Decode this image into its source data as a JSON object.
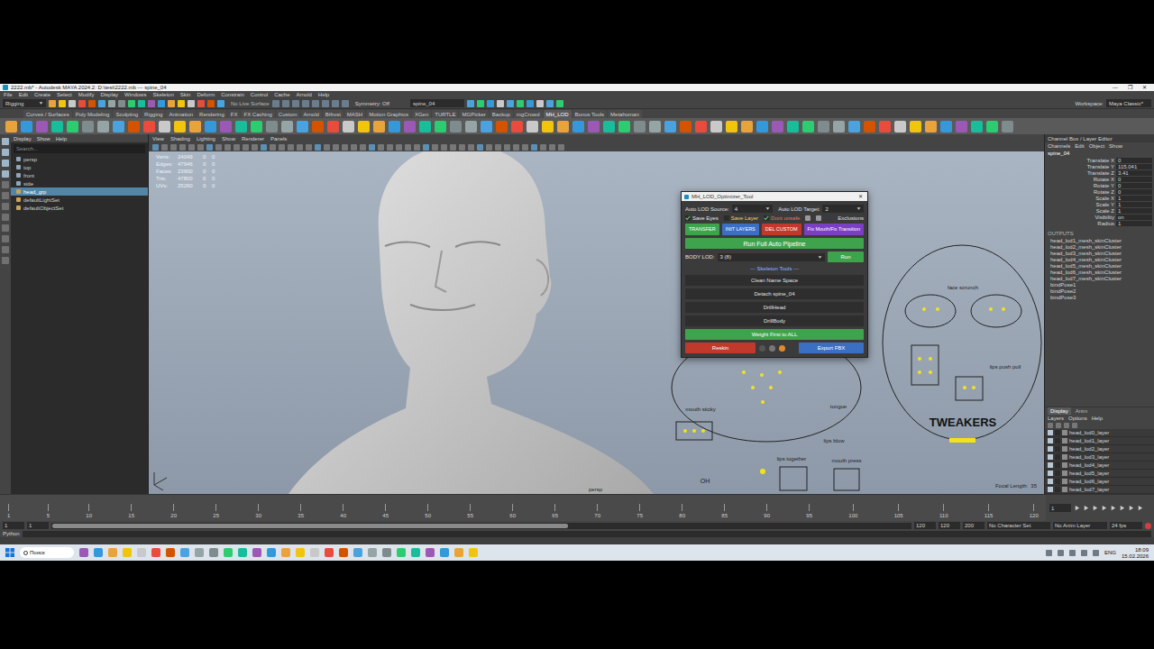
{
  "window": {
    "title": "2222.mb* - Autodesk MAYA 2024.2: D:\\test\\2222.mb   ---   spine_04",
    "controls": [
      "—",
      "❐",
      "✕"
    ]
  },
  "menu": [
    "File",
    "Edit",
    "Create",
    "Select",
    "Modify",
    "Display",
    "Windows",
    "Skeleton",
    "Skin",
    "Deform",
    "Constrain",
    "Control",
    "Cache",
    "Arnold",
    "Help"
  ],
  "status_line": {
    "mode": "Rigging",
    "live_surface": "No Live Surface",
    "symmetry": "Symmetry: Off",
    "object": "spine_04",
    "workspace_label": "Workspace:",
    "workspace": "Maya Classic*"
  },
  "shelf_tabs": [
    {
      "label": "Curves / Surfaces",
      "selected": false
    },
    {
      "label": "Poly Modeling",
      "selected": false
    },
    {
      "label": "Sculpting",
      "selected": false
    },
    {
      "label": "Rigging",
      "selected": false
    },
    {
      "label": "Animation",
      "selected": false
    },
    {
      "label": "Rendering",
      "selected": false
    },
    {
      "label": "FX",
      "selected": false
    },
    {
      "label": "FX Caching",
      "selected": false
    },
    {
      "label": "Custom",
      "selected": false
    },
    {
      "label": "Arnold",
      "selected": false
    },
    {
      "label": "Bifrost",
      "selected": false
    },
    {
      "label": "MASH",
      "selected": false
    },
    {
      "label": "Motion Graphics",
      "selected": false
    },
    {
      "label": "XGen",
      "selected": false
    },
    {
      "label": "TURTLE",
      "selected": false
    },
    {
      "label": "MGPicker",
      "selected": false
    },
    {
      "label": "Backup",
      "selected": false
    },
    {
      "label": "mgCrowd",
      "selected": false
    },
    {
      "label": "MH_LOD",
      "selected": true
    },
    {
      "label": "Bonus Tools",
      "selected": false
    },
    {
      "label": "Metahuman",
      "selected": false
    }
  ],
  "outliner": {
    "menu": [
      "Display",
      "Show",
      "Help"
    ],
    "search": "Search...",
    "items": [
      {
        "label": "persp",
        "selected": false
      },
      {
        "label": "top",
        "selected": false
      },
      {
        "label": "front",
        "selected": false
      },
      {
        "label": "side",
        "selected": false
      },
      {
        "label": "head_grp",
        "selected": true
      },
      {
        "label": "defaultLightSet",
        "selected": false
      },
      {
        "label": "defaultObjectSet",
        "selected": false
      }
    ]
  },
  "viewport": {
    "menu": [
      "View",
      "Shading",
      "Lighting",
      "Show",
      "Renderer",
      "Panels"
    ],
    "hud": [
      [
        "Verts:",
        "24049",
        "0",
        "0"
      ],
      [
        "Edges:",
        "47946",
        "0",
        "0"
      ],
      [
        "Faces:",
        "23900",
        "0",
        "0"
      ],
      [
        "Tris:",
        "47800",
        "0",
        "0"
      ],
      [
        "UVs:",
        "25260",
        "0",
        "0"
      ]
    ],
    "camera": "persp",
    "focal_label": "Focal Length:",
    "focal": "35"
  },
  "picker_labels": [
    {
      "text": "face scrunch"
    },
    {
      "text": "lips push pull"
    },
    {
      "text": "TWEAKERS"
    },
    {
      "text": "mouth sticky"
    },
    {
      "text": "tongue"
    },
    {
      "text": "lips blow"
    },
    {
      "text": "lips together"
    },
    {
      "text": "mouth press"
    },
    {
      "text": "OH"
    }
  ],
  "tool": {
    "title": "MH_LOD_Optimizer_Tool",
    "close": "✕",
    "source_label": "Auto LOD Source:",
    "source": "4",
    "target_label": "Auto LOD Target:",
    "target": "2",
    "options": [
      {
        "label": "Save Eyes",
        "checked": true,
        "color": "#e6e6e6"
      },
      {
        "label": "Save Layer",
        "checked": false,
        "color": "#e8d36a"
      },
      {
        "label": "Dont unsafe",
        "checked": true,
        "color": "#e07474"
      }
    ],
    "exclusions": "Exclusions",
    "actions": [
      {
        "label": "TRANSFER",
        "color": "#3fa34d"
      },
      {
        "label": "INIT LAYERS",
        "color": "#3a6fc4"
      },
      {
        "label": "DEL CUSTOM",
        "color": "#c0392b"
      },
      {
        "label": "Fix Mouth/Fix Transition",
        "color": "#7b3fc4"
      }
    ],
    "pipeline": "Run Full Auto Pipeline",
    "body_lod_label": "BODY LOD:",
    "body_lod": "3 (8)",
    "run": "Run",
    "skeleton_header": "--- Skeleton Tools ---",
    "skeleton": [
      "Clean Name Space",
      "Detach spine_04",
      "DrillHead",
      "DrillBody"
    ],
    "weight": "Weight First to ALL",
    "reskin": "Reskin",
    "export": "Export FBX"
  },
  "channel_box": {
    "title": "Channel Box / Layer Editor",
    "menu": [
      "Channels",
      "Edit",
      "Object",
      "Show"
    ],
    "node": "spine_04",
    "attributes": [
      {
        "name": "Translate X",
        "value": "0"
      },
      {
        "name": "Translate Y",
        "value": "115.041"
      },
      {
        "name": "Translate Z",
        "value": "3.41"
      },
      {
        "name": "Rotate X",
        "value": "0"
      },
      {
        "name": "Rotate Y",
        "value": "0"
      },
      {
        "name": "Rotate Z",
        "value": "0"
      },
      {
        "name": "Scale X",
        "value": "1"
      },
      {
        "name": "Scale Y",
        "value": "1"
      },
      {
        "name": "Scale Z",
        "value": "1"
      },
      {
        "name": "Visibility",
        "value": "on"
      },
      {
        "name": "Radius",
        "value": "1"
      }
    ],
    "outputs_label": "OUTPUTS",
    "outputs": [
      "head_lod1_mesh_skinCluster",
      "head_lod2_mesh_skinCluster",
      "head_lod3_mesh_skinCluster",
      "head_lod4_mesh_skinCluster",
      "head_lod5_mesh_skinCluster",
      "head_lod6_mesh_skinCluster",
      "head_lod7_mesh_skinCluster",
      "bindPose1",
      "bindPose2",
      "bindPose3"
    ]
  },
  "layers": {
    "tabs": [
      {
        "label": "Display",
        "selected": true
      },
      {
        "label": "Anim",
        "selected": false
      }
    ],
    "menu": [
      "Layers",
      "Options",
      "Help"
    ],
    "items": [
      {
        "label": "head_lod0_layer",
        "visible": true
      },
      {
        "label": "head_lod1_layer",
        "visible": true
      },
      {
        "label": "head_lod2_layer",
        "visible": true
      },
      {
        "label": "head_lod3_layer",
        "visible": true
      },
      {
        "label": "head_lod4_layer",
        "visible": true
      },
      {
        "label": "head_lod5_layer",
        "visible": true
      },
      {
        "label": "head_lod6_layer",
        "visible": true
      },
      {
        "label": "head_lod7_layer",
        "visible": true
      }
    ]
  },
  "timeline": {
    "ticks": [
      "1",
      "5",
      "10",
      "15",
      "20",
      "25",
      "30",
      "35",
      "40",
      "45",
      "50",
      "55",
      "60",
      "65",
      "70",
      "75",
      "80",
      "85",
      "90",
      "95",
      "100",
      "105",
      "110",
      "115",
      "120"
    ],
    "current": "1",
    "range": [
      "1",
      "1",
      "120",
      "120",
      "200"
    ],
    "character_set": "No Character Set",
    "anim_layer": "No Anim Layer",
    "fps": "24 fps"
  },
  "command_line": {
    "language": "Python"
  },
  "taskbar": {
    "search": "Поиск",
    "language": "ENG",
    "time": "18:09",
    "date": "15.02.2026"
  }
}
